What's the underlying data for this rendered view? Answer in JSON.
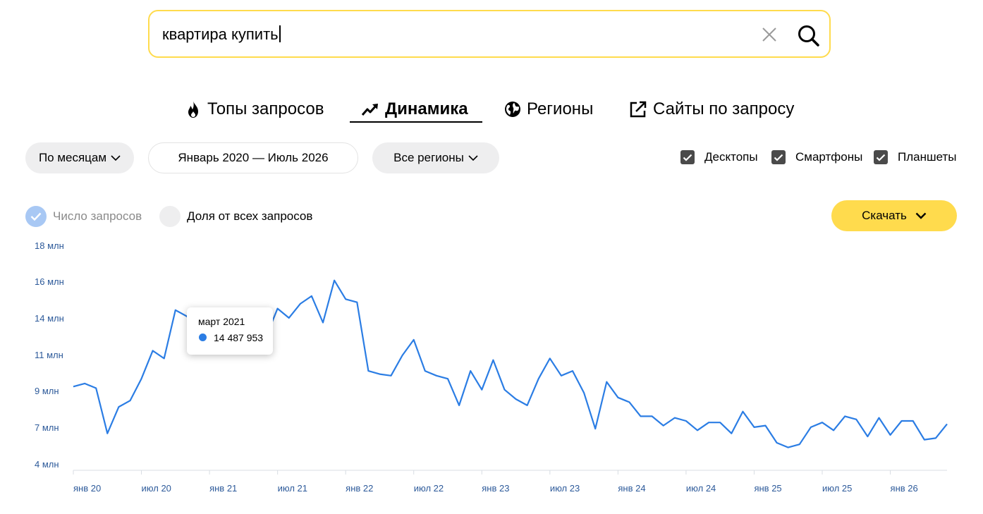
{
  "search": {
    "query": "квартира купить",
    "clear_icon": "close-icon",
    "search_icon": "magnifier-icon"
  },
  "tabs": [
    {
      "label": "Топы запросов",
      "icon": "flame-icon",
      "active": false
    },
    {
      "label": "Динамика",
      "icon": "trend-icon",
      "active": true
    },
    {
      "label": "Регионы",
      "icon": "globe-icon",
      "active": false
    },
    {
      "label": "Сайты по запросу",
      "icon": "external-link-icon",
      "active": false
    }
  ],
  "filters": {
    "period": "По месяцам",
    "range": "Январь 2020 — Июль 2026",
    "region": "Все регионы"
  },
  "devices": [
    {
      "label": "Десктопы",
      "checked": true
    },
    {
      "label": "Смартфоны",
      "checked": true
    },
    {
      "label": "Планшеты",
      "checked": true
    }
  ],
  "metrics": {
    "count_label": "Число запросов",
    "share_label": "Доля от всех запросов",
    "selected": "count"
  },
  "download_label": "Скачать",
  "colors": {
    "accent": "#ffdb4d",
    "line": "#2b7de4",
    "axis_text": "#2d5a9a"
  },
  "tooltip": {
    "title": "март 2021",
    "value": "14 487 953"
  },
  "chart_data": {
    "type": "line",
    "y_ticks": [
      "18 млн",
      "16 млн",
      "14 млн",
      "11 млн",
      "9 млн",
      "7 млн",
      "4 млн"
    ],
    "x_ticks": [
      "янв 20",
      "июл 20",
      "янв 21",
      "июл 21",
      "янв 22",
      "июл 22",
      "янв 23",
      "июл 23",
      "янв 24",
      "июл 24",
      "янв 25",
      "июл 25",
      "янв 26"
    ],
    "series": [
      {
        "values": [
          9.0,
          9.2,
          8.9,
          6.0,
          7.7,
          8.1,
          9.5,
          11.3,
          10.8,
          13.9,
          13.5,
          12.6,
          12.4,
          12.3,
          12.8,
          12.2,
          11.6,
          12.2,
          14.0,
          13.4,
          14.3,
          14.8,
          13.1,
          15.8,
          14.6,
          14.4,
          10.0,
          9.8,
          9.7,
          11.0,
          12.0,
          10.0,
          9.7,
          9.5,
          7.8,
          10.0,
          8.8,
          10.7,
          8.8,
          8.2,
          7.8,
          9.5,
          10.8,
          9.7,
          10.0,
          8.6,
          6.3,
          9.3,
          8.3,
          8.0,
          7.1,
          7.1,
          6.5,
          7.0,
          6.8,
          6.2,
          6.7,
          6.7,
          6.0,
          7.4,
          6.4,
          6.5,
          5.4,
          5.1,
          5.3,
          6.4,
          6.7,
          6.2,
          7.1,
          6.9,
          5.8,
          7.0,
          5.9,
          6.8,
          6.8,
          5.6,
          5.7,
          6.6
        ]
      }
    ]
  }
}
